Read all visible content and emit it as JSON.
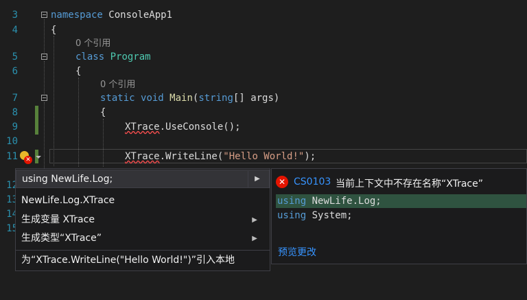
{
  "editor": {
    "line_numbers": [
      "3",
      "4",
      "5",
      "6",
      "7",
      "8",
      "9",
      "10",
      "11",
      "12",
      "13",
      "14",
      "15"
    ],
    "code": {
      "l3_kw": "namespace",
      "l3_name": " ConsoleApp1",
      "l4": "{",
      "lens1": "0 个引用",
      "l5_kw": "class",
      "l5_name": "Program",
      "l6": "{",
      "lens2": "0 个引用",
      "l7_static": "static",
      "l7_void": "void",
      "l7_main": "Main",
      "l7_open": "(",
      "l7_string": "string",
      "l7_rest": "[] args)",
      "l8": "{",
      "l9_xtrace": "XTrace",
      "l9_rest": ".UseConsole();",
      "l11_xtrace": "XTrace",
      "l11_mid": ".WriteLine(",
      "l11_str": "\"Hello World!\"",
      "l11_end": ");"
    }
  },
  "quick_actions": {
    "items": [
      {
        "label": "using NewLife.Log;"
      },
      {
        "label": "NewLife.Log.XTrace"
      },
      {
        "label": "生成变量 XTrace"
      },
      {
        "label": "生成类型“XTrace”"
      },
      {
        "label": "为“XTrace.WriteLine(\"Hello World!\")”引入本地"
      }
    ]
  },
  "preview": {
    "error_code": "CS0103",
    "error_message": "当前上下文中不存在名称“XTrace”",
    "lines": [
      {
        "kw": "using",
        "rest": " NewLife.Log;"
      },
      {
        "kw": "using",
        "rest": " System;"
      }
    ],
    "link": "预览更改"
  },
  "colors": {
    "background": "#1e1e1e",
    "keyword": "#569cd6",
    "type": "#4ec9b0",
    "string": "#d69d85",
    "line_number": "#2b91af",
    "error": "#e51400",
    "link": "#3794ff",
    "added_line": "#2f5340"
  },
  "icons": [
    "lightbulb-error-icon",
    "error-icon",
    "submenu-arrow-icon",
    "fold-icon"
  ]
}
